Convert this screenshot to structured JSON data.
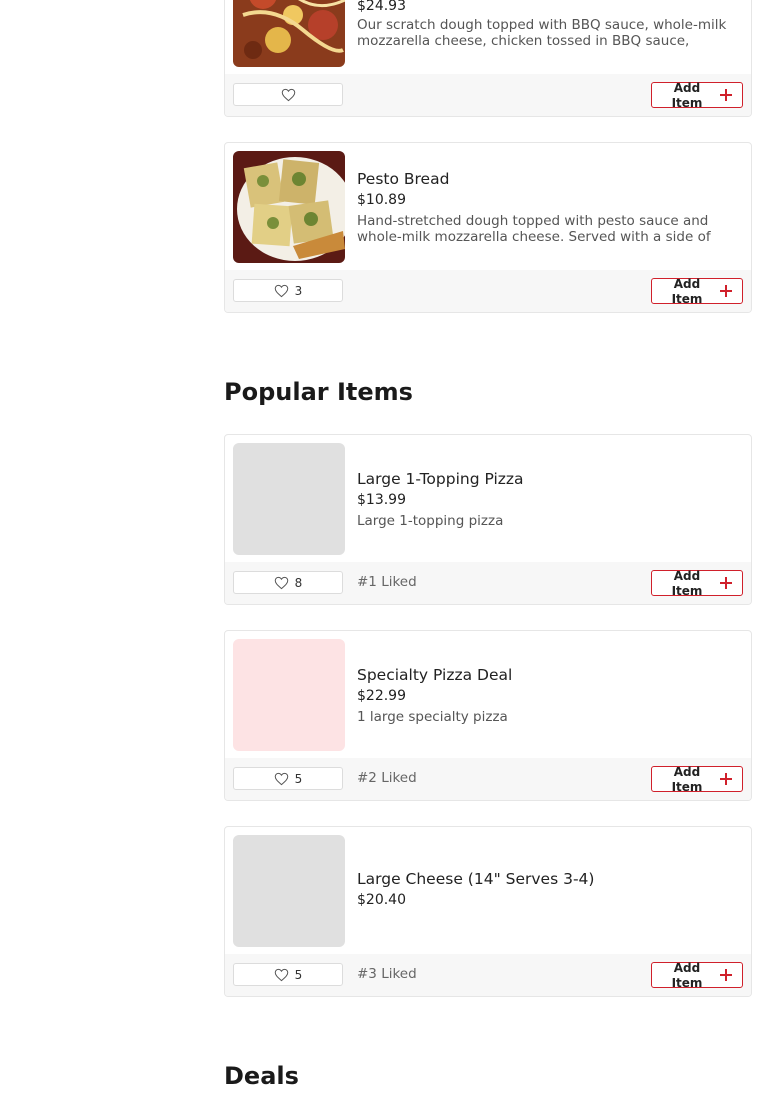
{
  "cards_top": [
    {
      "name": "",
      "price": "$24.93",
      "description": "Our scratch dough topped with BBQ sauce, whole-milk mozzarella cheese, chicken tossed in BBQ sauce, Canadian...",
      "likes": "",
      "add_label": "Add Item",
      "image": "bbq-chicken-pizza-photo"
    },
    {
      "name": "Pesto Bread",
      "price": "$10.89",
      "description": "Hand-stretched dough topped with pesto sauce and whole-milk mozzarella cheese. Served with a side of marinara...",
      "likes": "3",
      "add_label": "Add Item",
      "image": "pesto-bread-photo"
    }
  ],
  "popular": {
    "title": "Popular Items",
    "items": [
      {
        "name": "Large 1-Topping Pizza",
        "price": "$13.99",
        "description": "Large 1-topping pizza",
        "likes": "8",
        "rank": "#1 Liked",
        "add_label": "Add Item"
      },
      {
        "name": "Specialty Pizza Deal",
        "price": "$22.99",
        "description": "1 large specialty pizza",
        "likes": "5",
        "rank": "#2 Liked",
        "add_label": "Add Item"
      },
      {
        "name": "Large Cheese (14\" Serves 3-4)",
        "price": "$20.40",
        "description": "",
        "likes": "5",
        "rank": "#3 Liked",
        "add_label": "Add Item"
      }
    ]
  },
  "deals": {
    "title": "Deals"
  },
  "colors": {
    "accent": "#d0202b",
    "footer_bg": "#f7f7f7",
    "placeholder_gray": "#e0e0e0",
    "placeholder_pink": "#fde3e4"
  },
  "icons": {
    "like": "heart-outline-icon",
    "add": "plus-icon"
  }
}
